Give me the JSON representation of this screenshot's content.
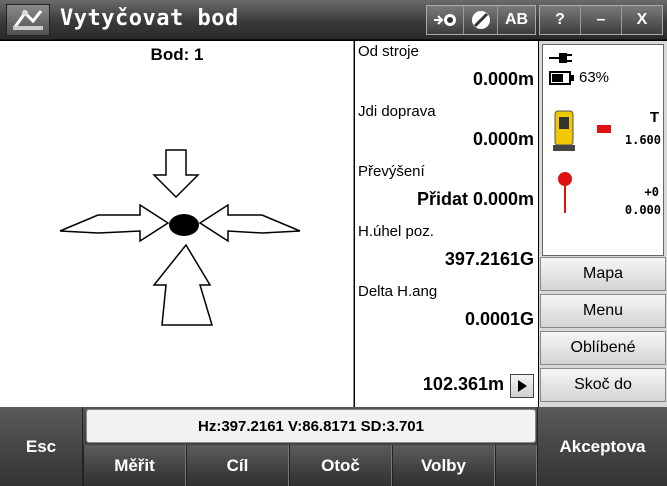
{
  "window": {
    "title": "Vytyčovat bod",
    "app_icon": "trimble-access-icon",
    "status_buttons": [
      {
        "name": "laser-pointer-icon"
      },
      {
        "name": "no-entry-icon"
      },
      {
        "label": "AB"
      }
    ],
    "controls": {
      "help": "?",
      "minimize": "–",
      "close": "X"
    }
  },
  "graphic": {
    "point_label": "Bod: 1"
  },
  "readouts": [
    {
      "label": "Od stroje",
      "value": "0.000m"
    },
    {
      "label": "Jdi doprava",
      "value": "0.000m"
    },
    {
      "label": "Převýšení",
      "value": "Přidat 0.000m"
    },
    {
      "label": "H.úhel poz.",
      "value": "397.2161G"
    },
    {
      "label": "Delta H.ang",
      "value": "0.0001G"
    }
  ],
  "distance_readout": "102.361m",
  "status": {
    "battery_percent": "63%",
    "instrument_letter": "T",
    "instrument_height": "1.600",
    "target_offset": "+0",
    "target_height": "0.000"
  },
  "side_buttons": [
    "Mapa",
    "Menu",
    "Oblíbené",
    "Skoč do"
  ],
  "bottom": {
    "esc": "Esc",
    "measurement_strip": "Hz:397.2161  V:86.8171  SD:3.701",
    "softkeys": [
      "Měřit",
      "Cíl",
      "Otoč",
      "Volby"
    ],
    "accept": "Akceptova"
  },
  "colors": {
    "titlebar": "#3a3a3a",
    "panel_bg": "#ffffff",
    "target_red": "#e01010",
    "prism_yellow": "#f0c800"
  }
}
